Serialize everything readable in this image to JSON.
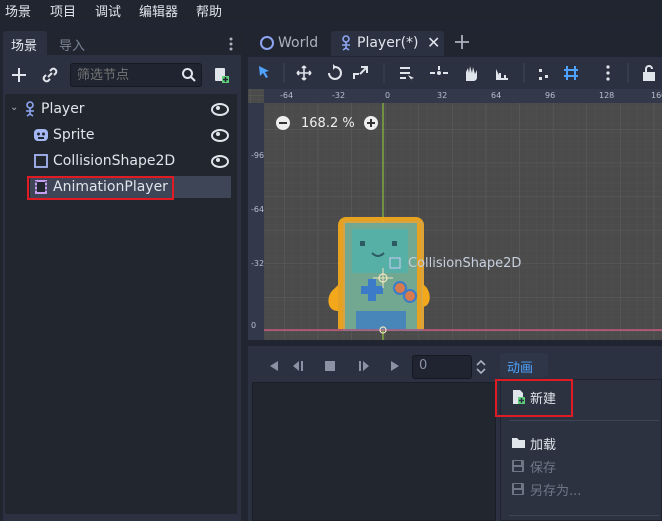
{
  "menubar": {
    "items": [
      "场景",
      "项目",
      "调试",
      "编辑器",
      "帮助"
    ]
  },
  "left_panel": {
    "tabs": [
      "场景",
      "导入"
    ],
    "filter_placeholder": "筛选节点",
    "tree": [
      {
        "label": "Player",
        "visible": true,
        "selected": false
      },
      {
        "label": "Sprite",
        "visible": true,
        "selected": false
      },
      {
        "label": "CollisionShape2D",
        "visible": true,
        "selected": false
      },
      {
        "label": "AnimationPlayer",
        "visible": false,
        "selected": true
      }
    ]
  },
  "editor": {
    "tabs": [
      {
        "label": "World",
        "active": false
      },
      {
        "label": "Player(*)",
        "active": true
      }
    ],
    "zoom_label": "168.2 %",
    "ruler_top_ticks": [
      "-64",
      "-32",
      "0",
      "32",
      "64",
      "96",
      "128",
      "160"
    ],
    "ruler_left_ticks": [
      "-96",
      "-64",
      "-32",
      "0"
    ],
    "collision_label": "CollisionShape2D"
  },
  "animation_panel": {
    "frame_value": "0",
    "animation_button": "动画",
    "dropdown": {
      "items": [
        {
          "label": "新建",
          "enabled": true
        },
        {
          "label": "加载",
          "enabled": true
        },
        {
          "label": "保存",
          "enabled": false
        },
        {
          "label": "另存为...",
          "enabled": false
        }
      ]
    }
  },
  "colors": {
    "accent": "#4fa3ff",
    "highlight_red": "#e01b24",
    "panel_bg": "#2b3140"
  }
}
